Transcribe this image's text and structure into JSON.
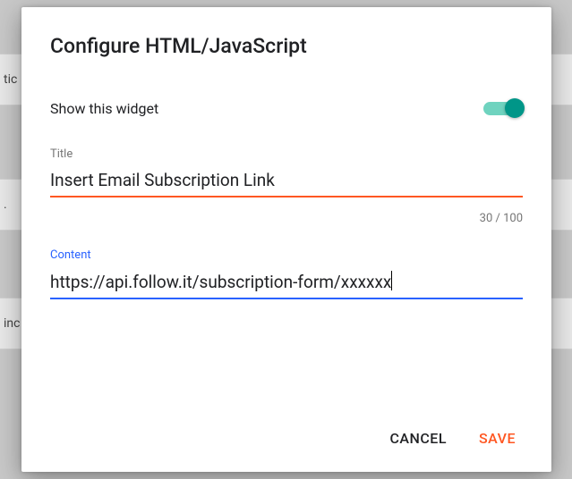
{
  "dialog": {
    "title": "Configure HTML/JavaScript",
    "toggle_label": "Show this widget",
    "toggle_on": true,
    "title_field": {
      "label": "Title",
      "value": "Insert Email Subscription Link",
      "counter": "30 / 100"
    },
    "content_field": {
      "label": "Content",
      "value": "https://api.follow.it/subscription-form/xxxxxx"
    },
    "actions": {
      "cancel": "CANCEL",
      "save": "SAVE"
    }
  },
  "bg_rows": {
    "r1": "tic",
    "r2": ".",
    "r3": "inc"
  }
}
